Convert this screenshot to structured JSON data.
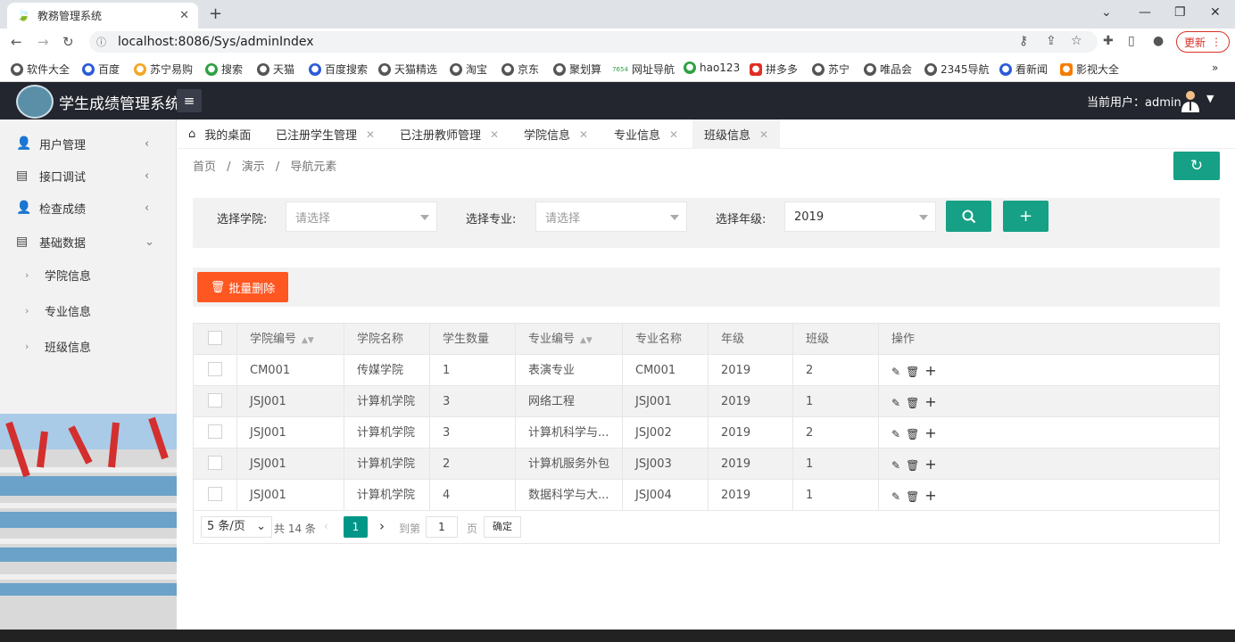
{
  "browser": {
    "tab_title": "教務管理系统",
    "url": "localhost:8086/Sys/adminIndex",
    "update_label": "更新",
    "bookmarks": [
      "软件大全",
      "百度",
      "苏宁易购",
      "搜索",
      "天猫",
      "百度搜索",
      "天猫精选",
      "淘宝",
      "京东",
      "聚划算",
      "网址导航",
      "hao123",
      "拼多多",
      "苏宁",
      "唯品会",
      "2345导航",
      "看新闻",
      "影视大全"
    ],
    "bookmarks_more": "»",
    "bookmark_badge_7654": "7654"
  },
  "app": {
    "title": "学生成绩管理系统",
    "current_user_label": "当前用户：admin"
  },
  "sidebar": {
    "items": [
      {
        "label": "用户管理"
      },
      {
        "label": "接口调试"
      },
      {
        "label": "检查成绩"
      },
      {
        "label": "基础数据"
      }
    ],
    "subitems": [
      {
        "label": "学院信息"
      },
      {
        "label": "专业信息"
      },
      {
        "label": "班级信息"
      }
    ]
  },
  "tabs": [
    {
      "label": "我的桌面"
    },
    {
      "label": "已注册学生管理"
    },
    {
      "label": "已注册教师管理"
    },
    {
      "label": "学院信息"
    },
    {
      "label": "专业信息"
    },
    {
      "label": "班级信息"
    }
  ],
  "breadcrumb": {
    "a": "首页",
    "b": "演示",
    "c": "导航元素",
    "sep": "/"
  },
  "filter": {
    "college_label": "选择学院:",
    "college_placeholder": "请选择",
    "major_label": "选择专业:",
    "major_placeholder": "请选择",
    "grade_label": "选择年级:",
    "grade_value": "2019"
  },
  "toolbar": {
    "batch_delete_label": "批量删除"
  },
  "table": {
    "headers": [
      "学院编号",
      "学院名称",
      "学生数量",
      "专业编号",
      "专业名称",
      "年级",
      "班级",
      "操作"
    ],
    "rows": [
      [
        "CM001",
        "传媒学院",
        "1",
        "表演专业",
        "CM001",
        "2019",
        "2"
      ],
      [
        "JSJ001",
        "计算机学院",
        "3",
        "网络工程",
        "JSJ001",
        "2019",
        "1"
      ],
      [
        "JSJ001",
        "计算机学院",
        "3",
        "计算机科学与...",
        "JSJ002",
        "2019",
        "2"
      ],
      [
        "JSJ001",
        "计算机学院",
        "2",
        "计算机服务外包",
        "JSJ003",
        "2019",
        "1"
      ],
      [
        "JSJ001",
        "计算机学院",
        "4",
        "数据科学与大...",
        "JSJ004",
        "2019",
        "1"
      ]
    ]
  },
  "pager": {
    "page_size": "5 条/页",
    "total": "共 14 条",
    "current_page": "1",
    "goto_label": "到第",
    "goto_value": "1",
    "page_unit": "页",
    "confirm_label": "确定"
  },
  "colors": {
    "primary": "#16a085",
    "danger": "#ff5722",
    "header_bg": "#23262e"
  }
}
